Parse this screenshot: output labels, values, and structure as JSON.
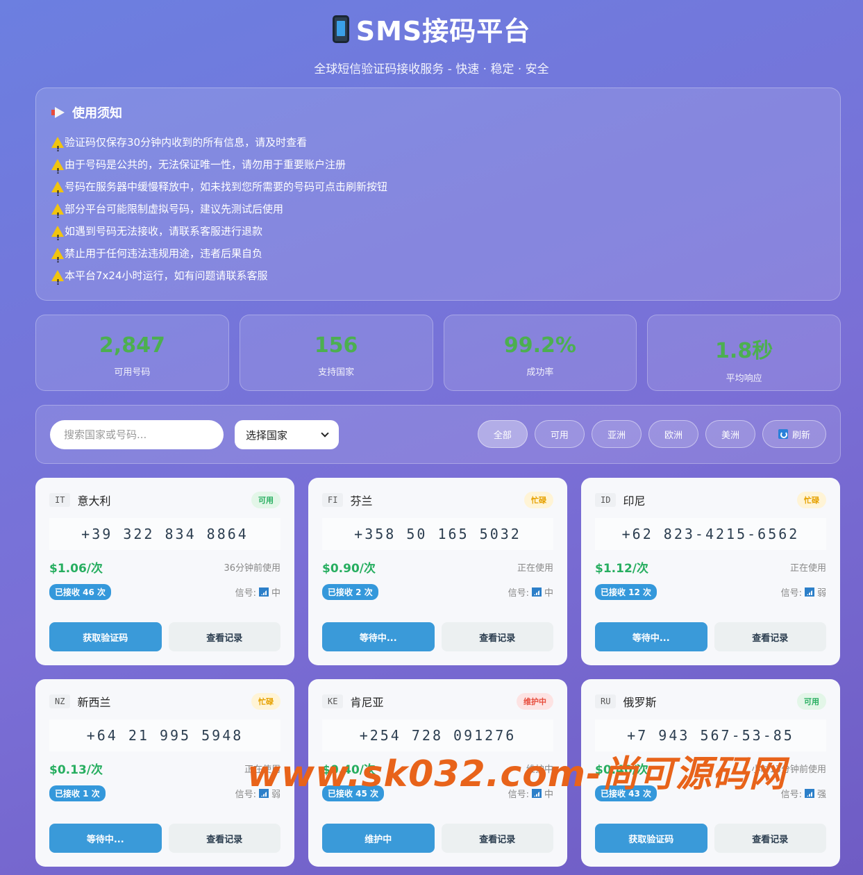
{
  "header": {
    "title": "SMS接码平台",
    "subtitle": "全球短信验证码接收服务 - 快速 · 稳定 · 安全",
    "icon": "phone-icon"
  },
  "notice": {
    "title": "使用须知",
    "items": [
      "验证码仅保存30分钟内收到的所有信息，请及时查看",
      "由于号码是公共的，无法保证唯一性，请勿用于重要账户注册",
      "号码在服务器中缓慢释放中，如未找到您所需要的号码可点击刷新按钮",
      "部分平台可能限制虚拟号码，建议先测试后使用",
      "如遇到号码无法接收，请联系客服进行退款",
      "禁止用于任何违法违规用途，违者后果自负",
      "本平台7x24小时运行，如有问题请联系客服"
    ]
  },
  "stats": [
    {
      "value": "2,847",
      "label": "可用号码"
    },
    {
      "value": "156",
      "label": "支持国家"
    },
    {
      "value": "99.2%",
      "label": "成功率"
    },
    {
      "value": "1.8秒",
      "label": "平均响应"
    }
  ],
  "filters": {
    "search_placeholder": "搜索国家或号码...",
    "select_value": "选择国家",
    "buttons": [
      "全部",
      "可用",
      "亚洲",
      "欧洲",
      "美洲",
      "刷新"
    ]
  },
  "cards": [
    {
      "cc": "IT",
      "country": "意大利",
      "status": "可用",
      "number": "+39 322 834 8864",
      "price": "$1.06/次",
      "usage": "36分钟前使用",
      "received": "已接收 46 次",
      "signal_label": "信号:",
      "signal": "中",
      "primary": "获取验证码",
      "secondary": "查看记录"
    },
    {
      "cc": "FI",
      "country": "芬兰",
      "status": "忙碌",
      "number": "+358 50 165 5032",
      "price": "$0.90/次",
      "usage": "正在使用",
      "received": "已接收 2 次",
      "signal_label": "信号:",
      "signal": "中",
      "primary": "等待中...",
      "secondary": "查看记录"
    },
    {
      "cc": "ID",
      "country": "印尼",
      "status": "忙碌",
      "number": "+62 823-4215-6562",
      "price": "$1.12/次",
      "usage": "正在使用",
      "received": "已接收 12 次",
      "signal_label": "信号:",
      "signal": "弱",
      "primary": "等待中...",
      "secondary": "查看记录"
    },
    {
      "cc": "NZ",
      "country": "新西兰",
      "status": "忙碌",
      "number": "+64 21 995 5948",
      "price": "$0.13/次",
      "usage": "正在使用",
      "received": "已接收 1 次",
      "signal_label": "信号:",
      "signal": "弱",
      "primary": "等待中...",
      "secondary": "查看记录"
    },
    {
      "cc": "KE",
      "country": "肯尼亚",
      "status": "维护中",
      "number": "+254 728 091276",
      "price": "$0.40/次",
      "usage": "维护中",
      "received": "已接收 45 次",
      "signal_label": "信号:",
      "signal": "中",
      "primary": "维护中",
      "secondary": "查看记录"
    },
    {
      "cc": "RU",
      "country": "俄罗斯",
      "status": "可用",
      "number": "+7 943 567-53-85",
      "price": "$0.40/次",
      "usage": "小时13分钟前使用",
      "received": "已接收 43 次",
      "signal_label": "信号:",
      "signal": "强",
      "primary": "获取验证码",
      "secondary": "查看记录"
    }
  ],
  "watermark": "www.sk032.com-尚可源码网",
  "colors": {
    "accent": "#3a9ad9",
    "success": "#27ae60",
    "busy": "#e6a100",
    "maintenance": "#e74c3c",
    "stat_value": "#4caf50"
  }
}
